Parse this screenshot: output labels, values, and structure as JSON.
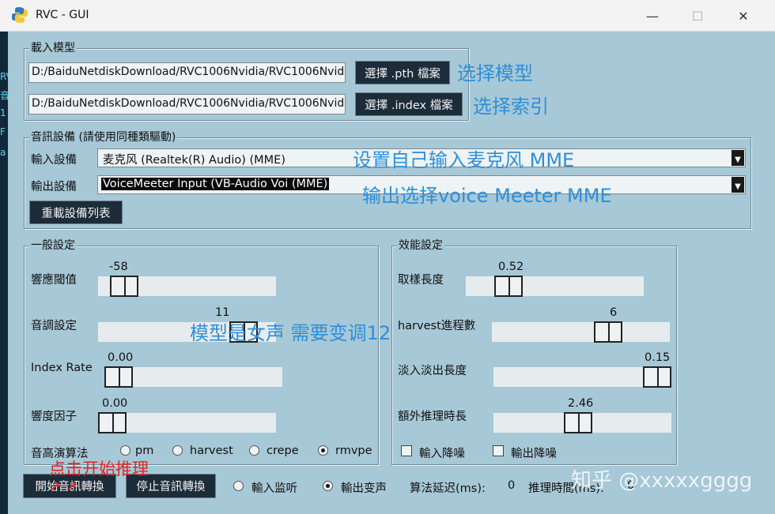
{
  "window": {
    "title": "RVC - GUI",
    "minimize_glyph": "—",
    "maximize_glyph": "☐",
    "close_glyph": "✕",
    "icon": "python-icon"
  },
  "left_fragment": [
    "RV",
    "音",
    "1",
    "F",
    "a"
  ],
  "load_model": {
    "title": "載入模型",
    "pth_path": "D:/BaiduNetdiskDownload/RVC1006Nvidia/RVC1006Nvidia",
    "index_path": "D:/BaiduNetdiskDownload/RVC1006Nvidia/RVC1006Nvidia",
    "pth_button": "選擇 .pth 檔案",
    "index_button": "選擇 .index 檔案"
  },
  "audio_device": {
    "title": "音訊設備 (請使用同種類驅動)",
    "input_label": "輸入設備",
    "input_value": "麦克风 (Realtek(R) Audio) (MME)",
    "output_label": "輸出設備",
    "output_value": "VoiceMeeter Input (VB-Audio Voi (MME)",
    "reload_button": "重載設備列表"
  },
  "general": {
    "title": "一般設定",
    "response_threshold": {
      "label": "響應閾值",
      "value": "-58",
      "fraction": 0.08
    },
    "pitch": {
      "label": "音調設定",
      "value": "11",
      "fraction": 0.88
    },
    "index_rate": {
      "label": "Index Rate",
      "value": "0.00",
      "fraction": 0.0
    },
    "rms_mix": {
      "label": "響度因子",
      "value": "0.00",
      "fraction": 0.0
    },
    "f0_label": "音高演算法",
    "f0_options": [
      "pm",
      "harvest",
      "crepe",
      "rmvpe"
    ],
    "f0_selected": "rmvpe"
  },
  "performance": {
    "title": "效能設定",
    "sample_length": {
      "label": "取樣長度",
      "value": "0.52",
      "fraction": 0.19
    },
    "harvest_procs": {
      "label": "harvest進程數",
      "value": "6",
      "fraction": 0.68
    },
    "crossfade": {
      "label": "淡入淡出長度",
      "value": "0.15",
      "fraction": 1.0
    },
    "extra_time": {
      "label": "額外推理時長",
      "value": "2.46",
      "fraction": 0.47
    },
    "input_denoise": "輸入降噪",
    "output_denoise": "輸出降噪"
  },
  "bottom": {
    "start_button": "開始音訊轉換",
    "stop_button": "停止音訊轉換",
    "input_monitor": "輸入监听",
    "output_voice": "輸出变声",
    "latency_label": "算法延迟(ms):",
    "latency_value": "0",
    "infer_label": "推理時間(ms):",
    "infer_value": "0"
  },
  "annotations": {
    "select_model": "选择模型",
    "select_index": "选择索引",
    "set_input": "设置自己输入麦克风 MME",
    "set_output": "输出选择voice Meeter MME",
    "pitch_note": "模型是女声 需要变调12",
    "start_note": "点击开始推理",
    "arrows": "↗ ↗"
  },
  "watermark": "知乎 @xxxxxgggg",
  "colors": {
    "background": "#a7c8d6",
    "dark_button": "#1d2c39",
    "annotation_blue": "#2e8fd9",
    "annotation_red": "#e02424"
  }
}
